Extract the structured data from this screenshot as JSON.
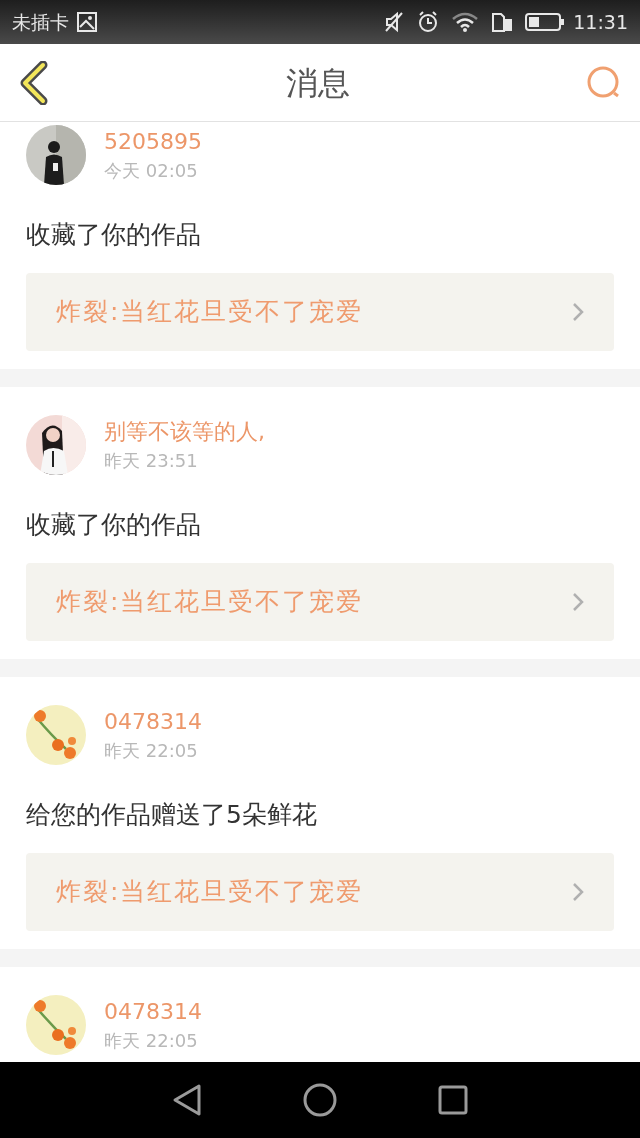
{
  "status_bar": {
    "carrier": "未插卡",
    "time": "11:31"
  },
  "header": {
    "title": "消息"
  },
  "messages": [
    {
      "user": "5205895",
      "time": "今天 02:05",
      "action": "收藏了你的作品",
      "work_title": "炸裂:当红花旦受不了宠爱"
    },
    {
      "user": "别等不该等的人,",
      "time": "昨天 23:51",
      "action": "收藏了你的作品",
      "work_title": "炸裂:当红花旦受不了宠爱"
    },
    {
      "user": "0478314",
      "time": "昨天 22:05",
      "action": "给您的作品赠送了5朵鲜花",
      "work_title": "炸裂:当红花旦受不了宠爱"
    },
    {
      "user": "0478314",
      "time": "昨天 22:05"
    }
  ]
}
